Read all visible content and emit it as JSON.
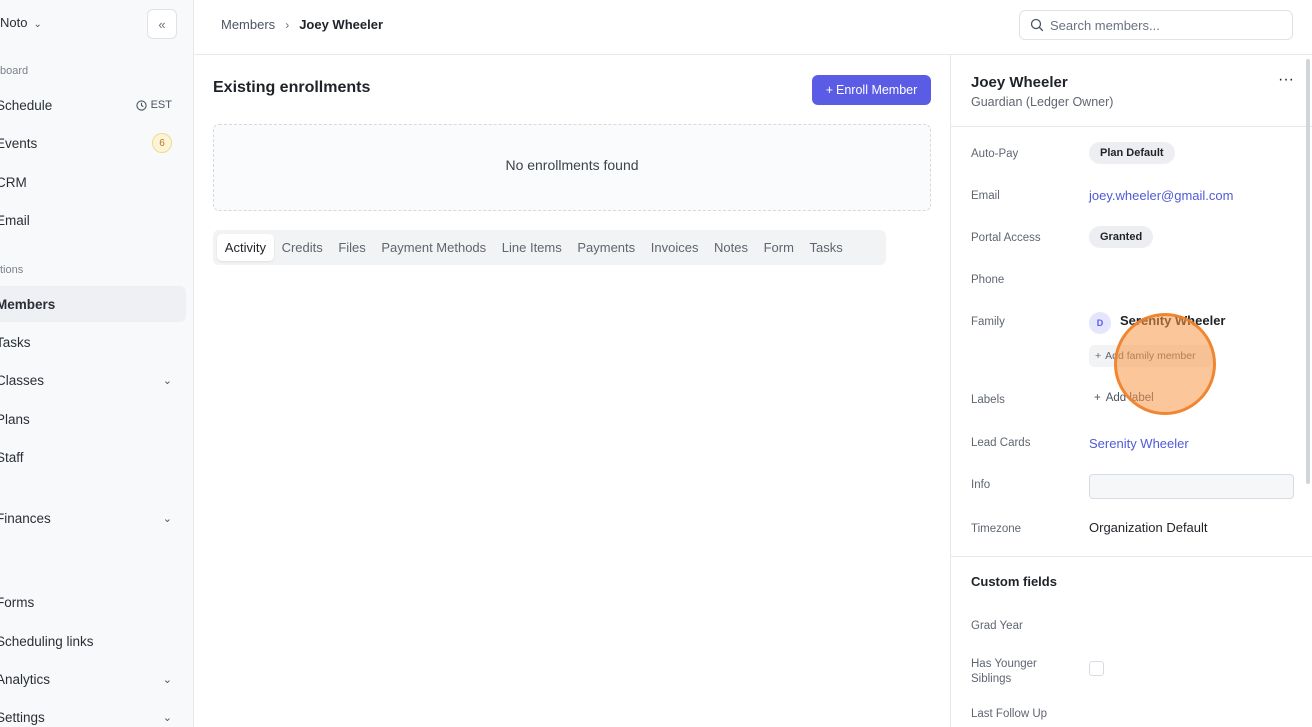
{
  "sidebar": {
    "org_name": "Noto",
    "collapse_glyph": "«",
    "sections": {
      "dashboard": "board",
      "operations": "tions"
    },
    "items": [
      {
        "label": "Schedule",
        "right": "EST"
      },
      {
        "label": "Events",
        "badge": "6"
      },
      {
        "label": "CRM"
      },
      {
        "label": "Email"
      },
      {
        "label": "Members"
      },
      {
        "label": "Tasks"
      },
      {
        "label": "Classes"
      },
      {
        "label": "Plans"
      },
      {
        "label": "Staff"
      },
      {
        "label": "Finances"
      },
      {
        "label": "Forms"
      },
      {
        "label": "Scheduling links"
      },
      {
        "label": "Analytics"
      },
      {
        "label": "Settings"
      }
    ],
    "active_item": "Members"
  },
  "header": {
    "breadcrumb": [
      "Members",
      "Joey Wheeler"
    ],
    "search_placeholder": "Search members..."
  },
  "main": {
    "title": "Existing enrollments",
    "enroll_button": "Enroll Member",
    "empty_message": "No enrollments found",
    "tabs": [
      "Activity",
      "Credits",
      "Files",
      "Payment Methods",
      "Line Items",
      "Payments",
      "Invoices",
      "Notes",
      "Form",
      "Tasks"
    ],
    "active_tab": "Activity"
  },
  "member": {
    "name": "Joey Wheeler",
    "role": "Guardian (Ledger Owner)",
    "more_glyph": "···",
    "fields": {
      "auto_pay_label": "Auto-Pay",
      "auto_pay_value": "Plan Default",
      "email_label": "Email",
      "email_value": "joey.wheeler@gmail.com",
      "portal_label": "Portal Access",
      "portal_value": "Granted",
      "phone_label": "Phone",
      "family_label": "Family",
      "family_initial": "D",
      "family_member": "Serenity Wheeler",
      "add_family": "Add family member",
      "labels_label": "Labels",
      "add_label": "Add label",
      "lead_cards_label": "Lead Cards",
      "lead_cards_value": "Serenity Wheeler",
      "info_label": "Info",
      "timezone_label": "Timezone",
      "timezone_value": "Organization Default"
    },
    "custom_fields": {
      "title": "Custom fields",
      "grad_year_label": "Grad Year",
      "younger_siblings_label_1": "Has Younger",
      "younger_siblings_label_2": "Siblings",
      "last_follow_up_label": "Last Follow Up"
    }
  },
  "colors": {
    "accent": "#5b5ce6",
    "link": "#4f5bd5",
    "cursor_highlight": "#f79846"
  }
}
